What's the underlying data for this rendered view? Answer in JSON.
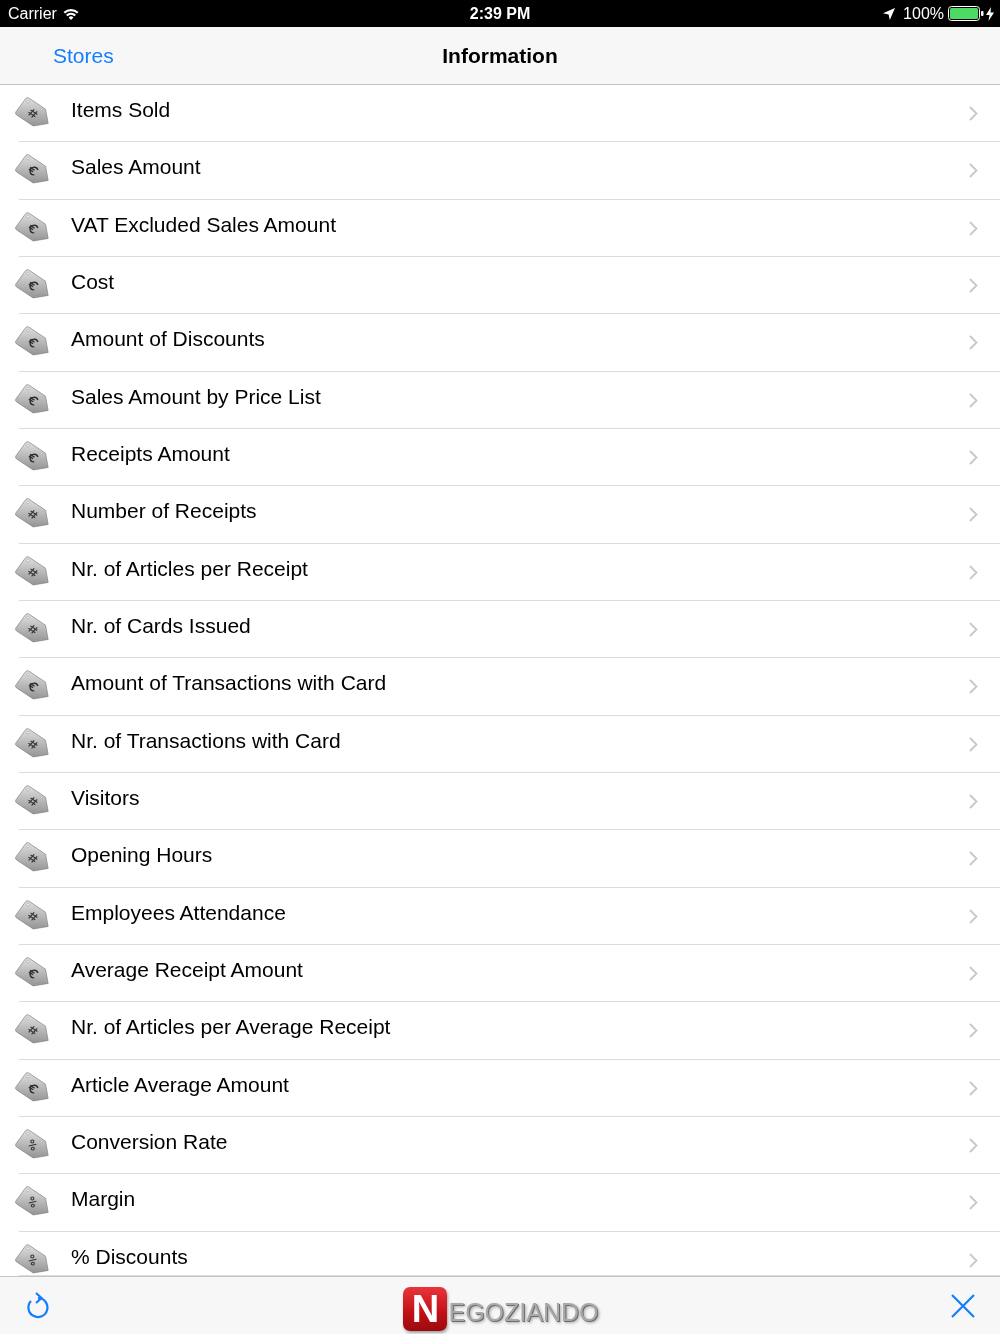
{
  "status_bar": {
    "carrier": "Carrier",
    "time": "2:39 PM",
    "battery": "100%"
  },
  "nav_bar": {
    "back": "Stores",
    "title": "Information"
  },
  "items": [
    {
      "kind": "count",
      "label": "Items Sold"
    },
    {
      "kind": "amount",
      "label": "Sales Amount"
    },
    {
      "kind": "amount",
      "label": "VAT Excluded Sales Amount"
    },
    {
      "kind": "amount",
      "label": "Cost"
    },
    {
      "kind": "amount",
      "label": "Amount of Discounts"
    },
    {
      "kind": "amount",
      "label": "Sales Amount by Price List"
    },
    {
      "kind": "amount",
      "label": "Receipts Amount"
    },
    {
      "kind": "count",
      "label": "Number of Receipts"
    },
    {
      "kind": "count",
      "label": "Nr. of Articles per Receipt"
    },
    {
      "kind": "count",
      "label": "Nr. of Cards Issued"
    },
    {
      "kind": "amount",
      "label": "Amount of Transactions with Card"
    },
    {
      "kind": "count",
      "label": "Nr. of Transactions with Card"
    },
    {
      "kind": "count",
      "label": "Visitors"
    },
    {
      "kind": "count",
      "label": "Opening Hours"
    },
    {
      "kind": "count",
      "label": "Employees Attendance"
    },
    {
      "kind": "amount",
      "label": "Average Receipt Amount"
    },
    {
      "kind": "count",
      "label": "Nr. of Articles per Average Receipt"
    },
    {
      "kind": "amount",
      "label": "Article Average Amount"
    },
    {
      "kind": "percent",
      "label": "Conversion Rate"
    },
    {
      "kind": "percent",
      "label": "Margin"
    },
    {
      "kind": "percent",
      "label": "% Discounts"
    }
  ],
  "toolbar": {
    "logo_initial": "N",
    "logo_rest": "EGOZIANDO"
  }
}
